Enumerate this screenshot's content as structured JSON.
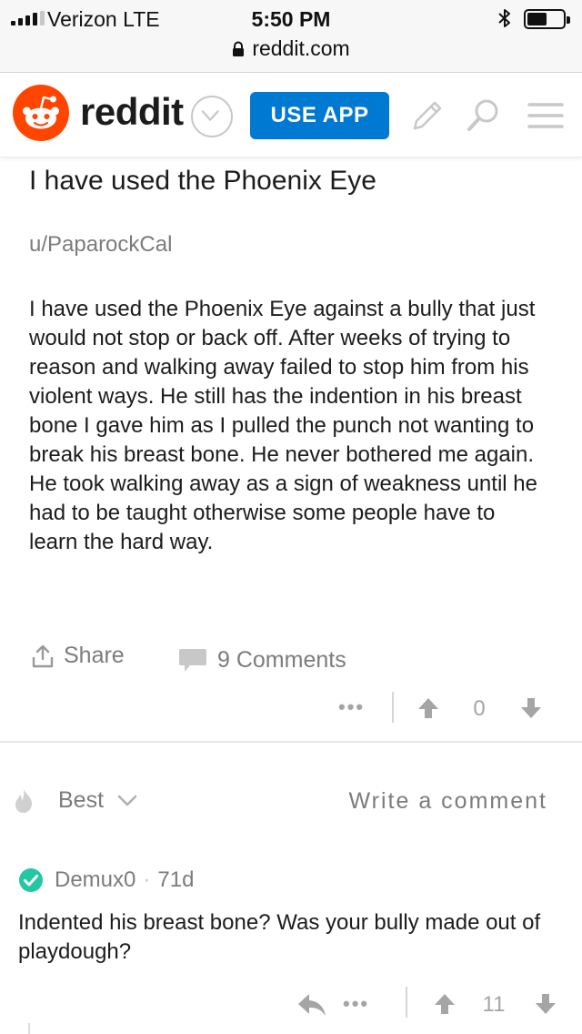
{
  "status_bar": {
    "carrier": "Verizon  LTE",
    "time": "5:50 PM",
    "url": "reddit.com",
    "battery_level": 0.55,
    "signal_bars": 4
  },
  "header": {
    "wordmark": "reddit",
    "use_app_label": "USE APP",
    "brand_color": "#ff4500",
    "button_color": "#0079d3"
  },
  "post": {
    "title": "I have used the Phoenix Eye",
    "author": "u/PaparockCal",
    "body": "I have used the Phoenix Eye against a bully that just would not stop or back off. After weeks of trying to reason and walking away failed to stop him from his violent ways. He still has the indention in his breast bone I gave him as I pulled the punch not wanting to break his breast bone. He never bothered me again. He took walking away as a sign of weakness until he had to be taught otherwise some people have to learn the hard way.",
    "share_label": "Share",
    "comments_label": "9 Comments",
    "more_label": "•••",
    "score": "0"
  },
  "comments_section": {
    "sort_label": "Best",
    "write_comment_label": "Write a comment"
  },
  "comment": {
    "author": "Demux0",
    "separator": "·",
    "age": "71d",
    "body": "Indented his breast bone? Was your bully made out of playdough?",
    "more_label": "•••",
    "score": "11",
    "badge_color": "#24c8a0"
  }
}
